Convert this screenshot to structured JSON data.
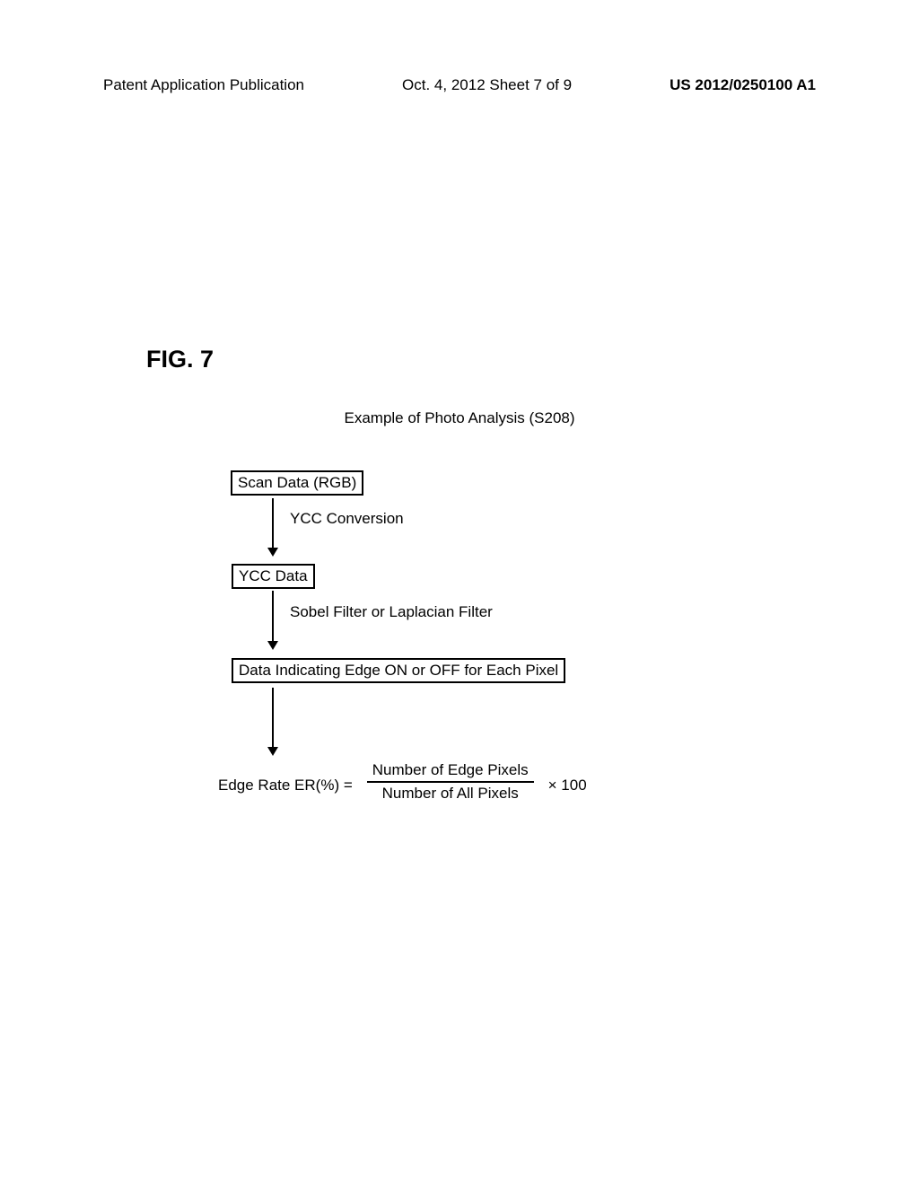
{
  "header": {
    "left": "Patent Application Publication",
    "center": "Oct. 4, 2012  Sheet 7 of 9",
    "right": "US 2012/0250100 A1"
  },
  "figure": {
    "label": "FIG. 7",
    "title": "Example of Photo Analysis (S208)",
    "boxes": {
      "scan_data": "Scan Data (RGB)",
      "ycc_data": "YCC Data",
      "edge_data": "Data Indicating Edge ON or OFF for Each Pixel"
    },
    "arrows": {
      "conversion": "YCC Conversion",
      "filter": "Sobel Filter or Laplacian Filter"
    },
    "formula": {
      "left": "Edge Rate ER(%) =",
      "numerator": "Number of Edge Pixels",
      "denominator": "Number of All Pixels",
      "multiplier": "× 100"
    }
  }
}
